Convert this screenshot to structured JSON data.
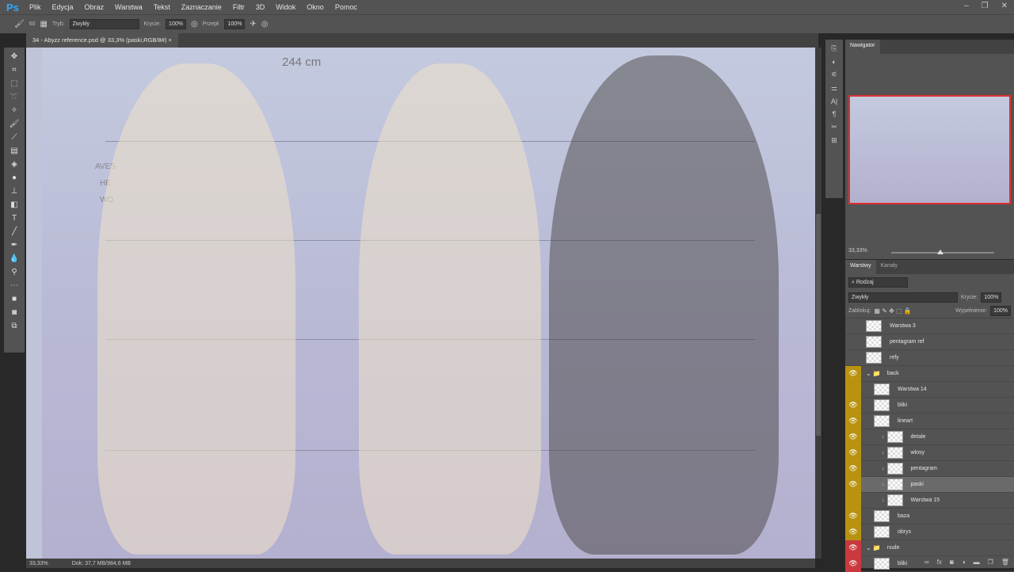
{
  "app": {
    "logo": "Ps",
    "menu": [
      "Plik",
      "Edycja",
      "Obraz",
      "Warstwa",
      "Tekst",
      "Zaznaczanie",
      "Filtr",
      "3D",
      "Widok",
      "Okno",
      "Pomoc"
    ]
  },
  "options": {
    "brush_size": "60",
    "mode_label": "Tryb:",
    "mode_value": "Zwykły",
    "opacity_label": "Krycie:",
    "opacity_value": "100%",
    "flow_label": "Przepł:",
    "flow_value": "100%"
  },
  "document": {
    "tab_title": "34 - Abyzz reference.psd @ 33,3% (paski,RGB/8#)",
    "close": "×",
    "height_label": "244 cm",
    "partial_labels": [
      "AVES",
      "HE",
      "WO"
    ]
  },
  "status": {
    "zoom": "33,33%",
    "doc_size": "Dok: 37,7 MB/984,6 MB"
  },
  "navigator": {
    "title": "Nawigator",
    "zoom": "33,33%"
  },
  "layers": {
    "tabs": [
      "Warstwy",
      "Kanały"
    ],
    "filter": "Rodzaj",
    "blend": "Zwykły",
    "opacity_label": "Krycie:",
    "opacity": "100%",
    "lock_label": "Zablokuj:",
    "fill_label": "Wypełnienie:",
    "fill": "100%",
    "items": [
      {
        "name": "Warstwa 3",
        "eye": "none",
        "indent": 0
      },
      {
        "name": "pentagram ref",
        "eye": "none",
        "indent": 0
      },
      {
        "name": "refy",
        "eye": "none",
        "indent": 0
      },
      {
        "name": "back",
        "eye": "yellow",
        "group": true,
        "indent": 0
      },
      {
        "name": "Warstwa 14",
        "eye": "yellow-off",
        "indent": 1
      },
      {
        "name": "bliki",
        "eye": "yellow",
        "indent": 1
      },
      {
        "name": "lineart",
        "eye": "yellow",
        "indent": 1
      },
      {
        "name": "detale",
        "eye": "yellow",
        "indent": 2
      },
      {
        "name": "wlosy",
        "eye": "yellow",
        "indent": 2
      },
      {
        "name": "pentagram",
        "eye": "yellow",
        "indent": 2
      },
      {
        "name": "paski",
        "eye": "yellow",
        "indent": 2,
        "selected": true
      },
      {
        "name": "Warstwa 15",
        "eye": "yellow-off",
        "indent": 2
      },
      {
        "name": "baza",
        "eye": "yellow",
        "indent": 1
      },
      {
        "name": "obrys",
        "eye": "yellow",
        "indent": 1
      },
      {
        "name": "nude",
        "eye": "red",
        "group": true,
        "indent": 0
      },
      {
        "name": "bliki",
        "eye": "red",
        "indent": 1
      }
    ]
  },
  "colors": {
    "accent": "#31a8ff",
    "eye_yellow": "#b9930f",
    "eye_red": "#c9393e",
    "nav_frame": "#e03030"
  }
}
